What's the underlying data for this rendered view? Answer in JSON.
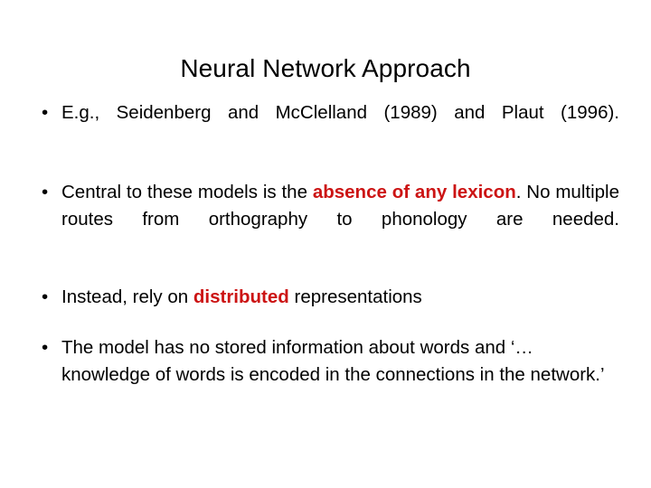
{
  "slide": {
    "title": "Neural Network Approach",
    "bullet_marker": "•",
    "accent_color": "#CC1414",
    "text_color": "#000000",
    "background_color": "#FFFFFF",
    "bullets": [
      {
        "id": "bullet-references",
        "full_text": "E.g., Seidenberg and McClelland (1989) and Plaut (1996).",
        "segments": [
          {
            "text": "E.g., Seidenberg and McClelland (1989) and Plaut (1996).",
            "style": "normal"
          }
        ]
      },
      {
        "id": "bullet-no-lexicon",
        "full_text": "Central to these models is the absence of any lexicon. No multiple routes from orthography to phonology are needed.",
        "segments": [
          {
            "text": "Central to these models is the ",
            "style": "normal"
          },
          {
            "text": "absence of any lexicon",
            "style": "highlight"
          },
          {
            "text": ". No multiple routes from orthography to phonology are needed.",
            "style": "normal"
          }
        ]
      },
      {
        "id": "bullet-distributed",
        "full_text": "Instead, rely on distributed representations",
        "segments": [
          {
            "text": "Instead, rely on ",
            "style": "normal"
          },
          {
            "text": "distributed",
            "style": "highlight"
          },
          {
            "text": " representations",
            "style": "normal"
          }
        ]
      },
      {
        "id": "bullet-no-stored-info",
        "full_text": "The model has no stored information about words and ‘… knowledge of words is encoded in the connections in the network.’",
        "segments": [
          {
            "text": "The model has no stored information about words and ‘… knowledge of words is encoded in the connections in the network.’",
            "style": "normal"
          }
        ]
      }
    ]
  }
}
